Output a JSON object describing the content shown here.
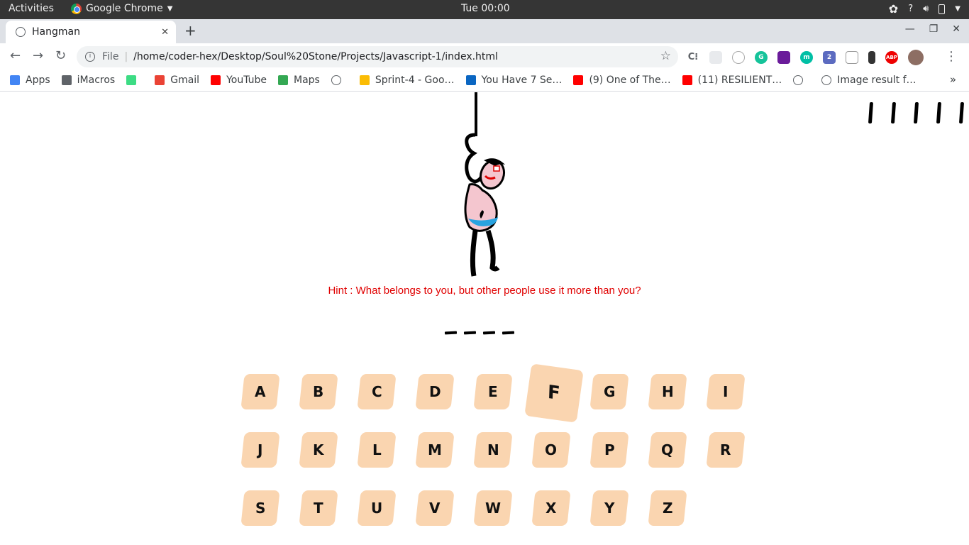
{
  "topbar": {
    "activities": "Activities",
    "app_name": "Google Chrome",
    "clock": "Tue 00:00",
    "help": "?"
  },
  "tab": {
    "title": "Hangman"
  },
  "toolbar": {
    "scheme": "File",
    "url": "/home/coder-hex/Desktop/Soul%20Stone/Projects/Javascript-1/index.html",
    "extension_badge": "2",
    "abp_label": "ABP"
  },
  "bookmarks": [
    {
      "label": "Apps",
      "icon": "apps-grid-icon",
      "color": "#4285f4"
    },
    {
      "label": "iMacros",
      "icon": "folder-icon",
      "color": "#5f6368"
    },
    {
      "label": "",
      "icon": "android-icon",
      "color": "#3ddc84"
    },
    {
      "label": "Gmail",
      "icon": "gmail-icon",
      "color": "#ea4335"
    },
    {
      "label": "YouTube",
      "icon": "youtube-icon",
      "color": "#ff0000"
    },
    {
      "label": "Maps",
      "icon": "maps-pin-icon",
      "color": "#34a853"
    },
    {
      "label": "",
      "icon": "globe-icon",
      "color": "#5f6368"
    },
    {
      "label": "Sprint-4 - Goo…",
      "icon": "drive-icon",
      "color": "#fbbc04"
    },
    {
      "label": "You Have 7 Se…",
      "icon": "linkedin-icon",
      "color": "#0a66c2"
    },
    {
      "label": "(9) One of The…",
      "icon": "youtube-icon",
      "color": "#ff0000"
    },
    {
      "label": "(11) RESILIENT…",
      "icon": "youtube-icon",
      "color": "#ff0000"
    },
    {
      "label": "",
      "icon": "globe-icon",
      "color": "#5f6368"
    },
    {
      "label": "Image result f…",
      "icon": "globe-icon",
      "color": "#5f6368"
    }
  ],
  "game": {
    "lives_remaining": 5,
    "hint": "Hint : What belongs to you, but other people use it more than you?",
    "blank_count": 4,
    "letters": [
      "A",
      "B",
      "C",
      "D",
      "E",
      "F",
      "G",
      "H",
      "I",
      "J",
      "K",
      "L",
      "M",
      "N",
      "O",
      "P",
      "Q",
      "R",
      "S",
      "T",
      "U",
      "V",
      "W",
      "X",
      "Y",
      "Z"
    ],
    "hovered_letter": "F",
    "key_color": "#fad5b0",
    "hint_color": "#e00000"
  }
}
